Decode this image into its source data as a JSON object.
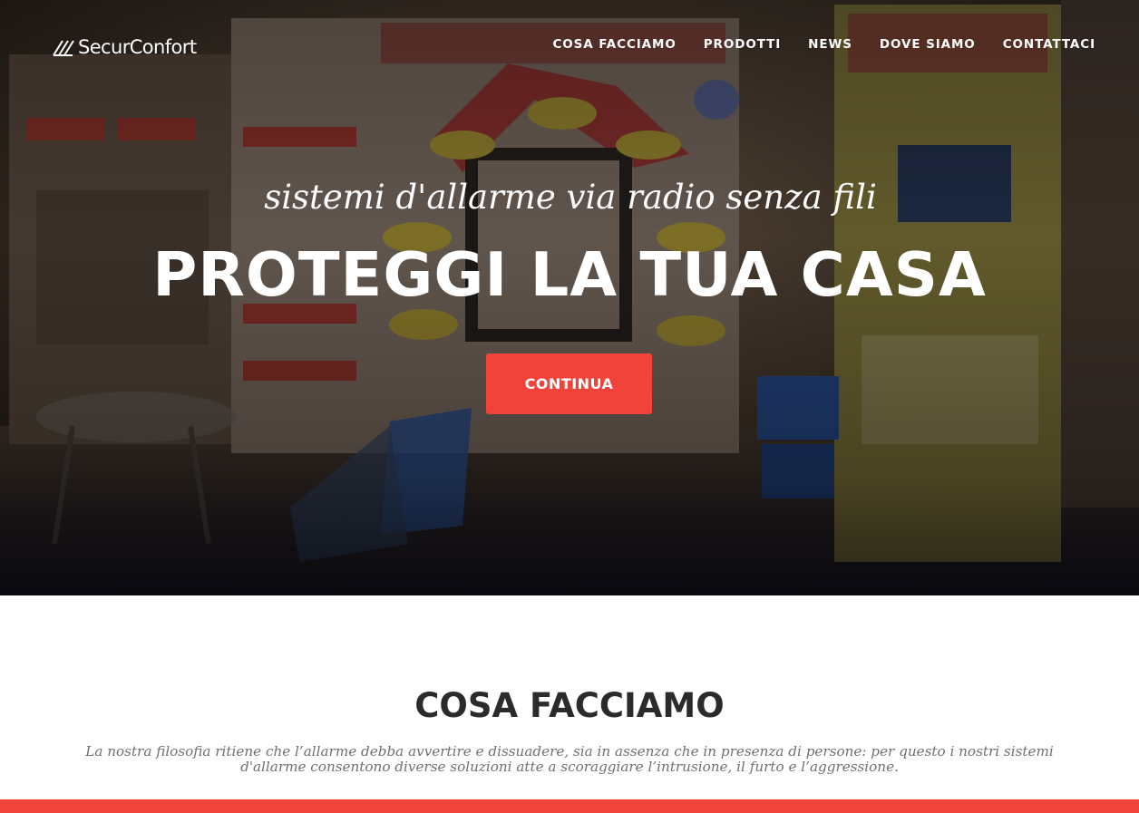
{
  "brand": {
    "name": "SecurConfort",
    "icon": "stripes-logo-icon"
  },
  "nav": {
    "items": [
      {
        "label": "COSA FACCIAMO"
      },
      {
        "label": "PRODOTTI"
      },
      {
        "label": "NEWS"
      },
      {
        "label": "DOVE SIAMO"
      },
      {
        "label": "CONTATTACI"
      }
    ]
  },
  "hero": {
    "subtitle": "sistemi d'allarme via radio senza fili",
    "title": "PROTEGGI LA TUA CASA",
    "cta_label": "CONTINUA",
    "background_image": "trade-fair-booth-photo"
  },
  "section": {
    "title": "COSA FACCIAMO",
    "text": "La nostra filosofia ritiene che l’allarme debba avvertire e dissuadere, sia in assenza che in presenza di persone: per questo i nostri sistemi d'allarme consentono diverse soluzioni atte a scoraggiare l’intrusione, il furto e l’aggressione."
  },
  "colors": {
    "accent": "#f2433a",
    "heading": "#2c2b2b",
    "body_text": "#707070",
    "nav_text": "#ffffff"
  }
}
